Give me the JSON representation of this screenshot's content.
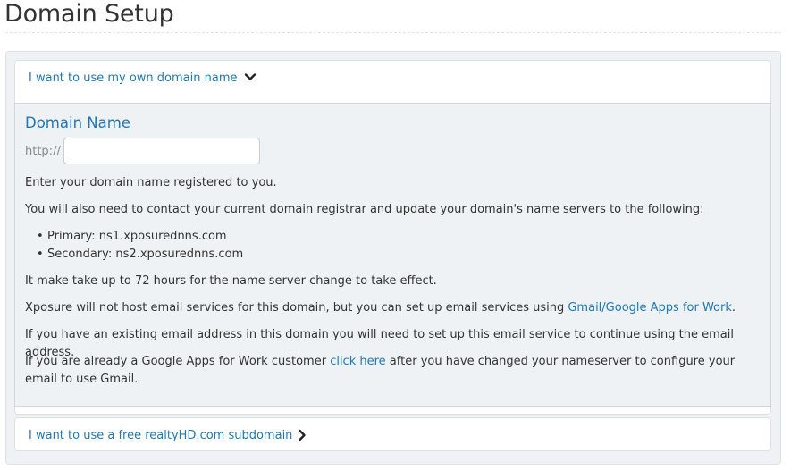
{
  "page": {
    "title": "Domain Setup"
  },
  "own_domain": {
    "header_label": "I want to use my own domain name",
    "section_title": "Domain Name",
    "url_prefix": "http://",
    "domain_value": "",
    "intro_text": "Enter your domain name registered to you.",
    "registrar_text": "You will also need to contact your current domain registrar and update your domain's name servers to the following:",
    "nameservers": [
      {
        "label": "Primary: ns1.xposurednns.com"
      },
      {
        "label": "Secondary: ns2.xposurednns.com"
      }
    ],
    "propagation_text": "It make take up to 72 hours for the name server change to take effect.",
    "email_text_before": "Xposure will not host email services for this domain, but you can set up email services using ",
    "email_link": "Gmail/Google Apps for Work",
    "email_text_after": ".",
    "existing_email_text": "If you have an existing email address in this domain you will need to set up this email service to continue using the email address.",
    "customer_text_before": "If you are already a Google Apps for Work customer ",
    "customer_link": "click here",
    "customer_text_after": " after you have changed your nameserver to configure your email to use Gmail."
  },
  "subdomain": {
    "header_label": "I want to use a free realtyHD.com subdomain"
  },
  "colors": {
    "link": "#1f78b4",
    "panel_bg": "#eef2f5"
  },
  "icons": {
    "expanded": "chevron-down-icon",
    "collapsed": "chevron-right-icon"
  }
}
